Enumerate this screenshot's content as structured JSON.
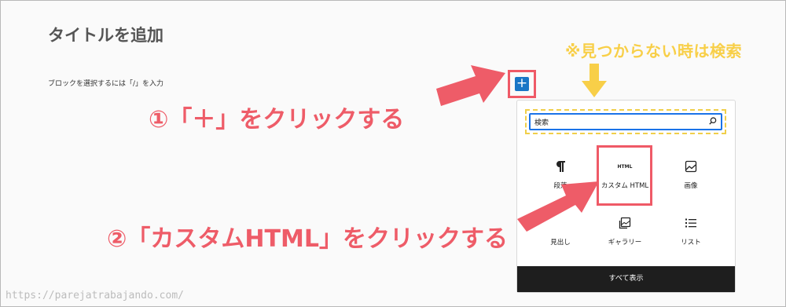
{
  "editor": {
    "title_placeholder": "タイトルを追加",
    "block_hint": "ブロックを選択するには「/」を入力"
  },
  "annotations": {
    "search_note": "※見つからない時は検索",
    "step1": "①「＋」をクリックする",
    "step2": "②「カスタムHTML」をクリックする",
    "arrow_color": "#ee5c68",
    "note_color": "#f8cf48"
  },
  "inserter": {
    "add_icon": "+",
    "search_value": "検索",
    "blocks": [
      {
        "label": "段落",
        "icon": "paragraph-icon"
      },
      {
        "label": "カスタム HTML",
        "icon": "html-icon",
        "icon_text": "HTML"
      },
      {
        "label": "画像",
        "icon": "image-icon"
      },
      {
        "label": "見出し",
        "icon": "heading-icon"
      },
      {
        "label": "ギャラリー",
        "icon": "gallery-icon"
      },
      {
        "label": "リスト",
        "icon": "list-icon"
      }
    ],
    "show_all_label": "すべて表示"
  },
  "watermark": "https://parejatrabajando.com/"
}
